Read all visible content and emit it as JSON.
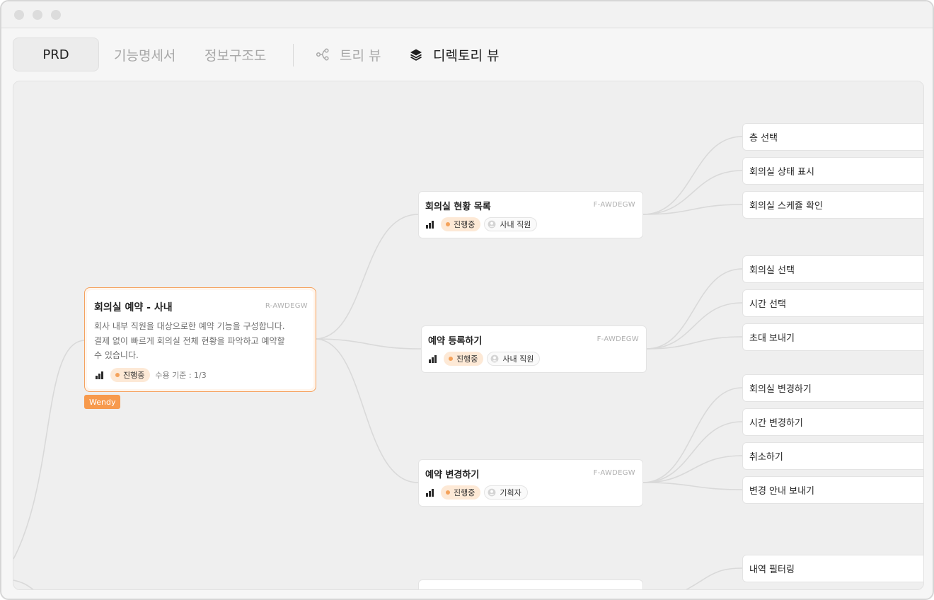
{
  "tabs": {
    "prd": "PRD",
    "spec": "기능명세서",
    "ia": "정보구조도",
    "tree_view": "트리 뷰",
    "directory_view": "디렉토리 뷰"
  },
  "root": {
    "title": "회의실 예약 - 사내",
    "code": "R-AWDEGW",
    "desc_lines": [
      "회사 내부 직원을 대상으로한 예약 기능을 구성합니다.",
      "결제 없이 빠르게 회의실 전체 현황을 파악하고 예약할",
      "수 있습니다."
    ],
    "status": "진행중",
    "criteria": "수용 기준 : 1/3",
    "owner": "Wendy"
  },
  "features": [
    {
      "title": "회의실 현황 목록",
      "code": "F-AWDEGW",
      "status": "진행중",
      "role": "사내 직원"
    },
    {
      "title": "예약 등록하기",
      "code": "F-AWDEGW",
      "status": "진행중",
      "role": "사내 직원"
    },
    {
      "title": "예약 변경하기",
      "code": "F-AWDEGW",
      "status": "진행중",
      "role": "기획자"
    },
    {
      "title": "",
      "code": "",
      "status": "",
      "role": ""
    }
  ],
  "leaves": [
    "층 선택",
    "회의실 상태 표시",
    "회의실 스케쥴 확인",
    "회의실 선택",
    "시간 선택",
    "초대 보내기",
    "회의실 변경하기",
    "시간 변경하기",
    "취소하기",
    "변경 안내 보내기",
    "내역 필터링"
  ],
  "colors": {
    "accent": "#f79a4d",
    "status_bg": "#fde9d6",
    "status_dot": "#f4a25b",
    "canvas": "#efefef",
    "link": "#d9d9d9"
  },
  "icons": {
    "tree_view": "tree-branch-icon",
    "directory_view": "layers-icon",
    "priority": "signal-bars-icon",
    "role": "user-circle-icon"
  }
}
